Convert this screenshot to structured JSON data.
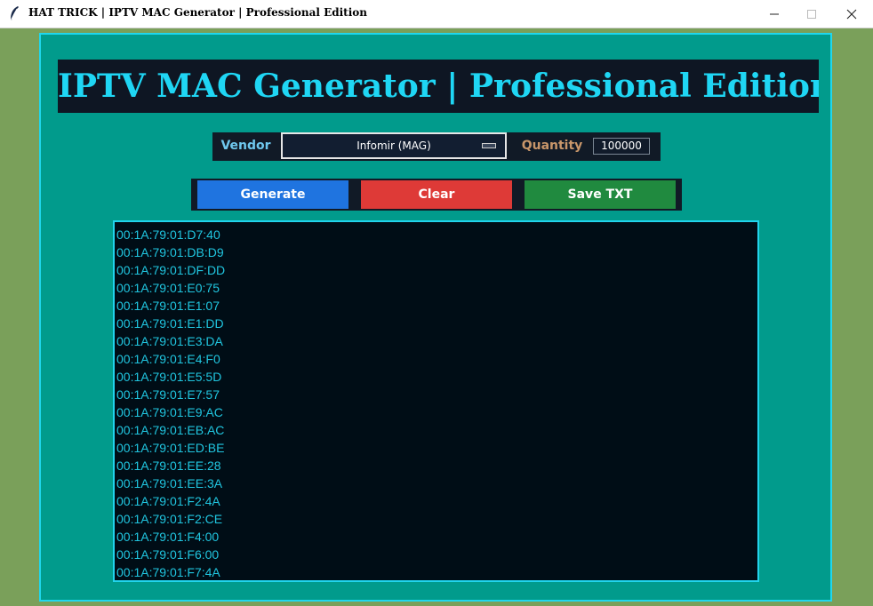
{
  "window": {
    "title": "HAT TRICK | IPTV MAC Generator | Professional Edition",
    "icon": "feather-icon"
  },
  "header": {
    "title": "IPTV MAC Generator | Professional Edition"
  },
  "controls": {
    "vendor_label": "Vendor",
    "vendor_value": "Infomir (MAG)",
    "quantity_label": "Quantity",
    "quantity_value": "100000"
  },
  "buttons": {
    "generate": "Generate",
    "clear": "Clear",
    "save": "Save TXT"
  },
  "output": {
    "macs": [
      "00:1A:79:01:D7:40",
      "00:1A:79:01:DB:D9",
      "00:1A:79:01:DF:DD",
      "00:1A:79:01:E0:75",
      "00:1A:79:01:E1:07",
      "00:1A:79:01:E1:DD",
      "00:1A:79:01:E3:DA",
      "00:1A:79:01:E4:F0",
      "00:1A:79:01:E5:5D",
      "00:1A:79:01:E7:57",
      "00:1A:79:01:E9:AC",
      "00:1A:79:01:EB:AC",
      "00:1A:79:01:ED:BE",
      "00:1A:79:01:EE:28",
      "00:1A:79:01:EE:3A",
      "00:1A:79:01:F2:4A",
      "00:1A:79:01:F2:CE",
      "00:1A:79:01:F4:00",
      "00:1A:79:01:F6:00",
      "00:1A:79:01:F7:4A"
    ]
  },
  "colors": {
    "accent": "#1fd6f4",
    "panel_bg": "#019b8c",
    "generate": "#1f74e0",
    "clear": "#de3a37",
    "save": "#208a3f"
  }
}
